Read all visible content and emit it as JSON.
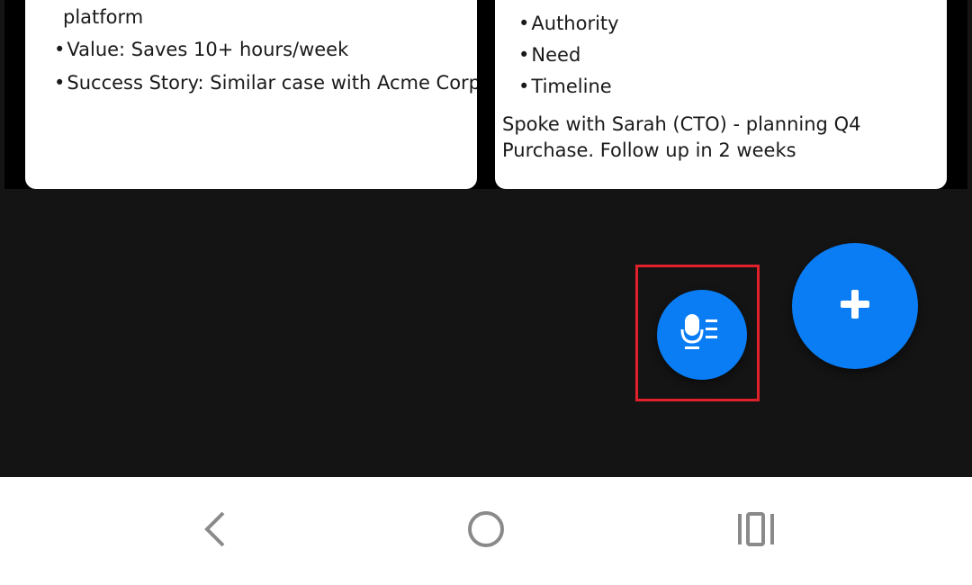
{
  "notes": {
    "left_card": {
      "top_line": "platform",
      "bullets": [
        "Value: Saves 10+ hours/week",
        "Success Story: Similar case with Acme Corp"
      ]
    },
    "right_card": {
      "bullets": [
        "Authority",
        "Need",
        "Timeline"
      ],
      "summary": "Spoke with Sarah (CTO) - planning Q4 Purchase. Follow up in 2 weeks"
    }
  },
  "fabs": {
    "voice_note_icon": "microphone-list-icon",
    "add_icon": "plus-icon",
    "accent_color": "#0a7df5"
  },
  "highlight": {
    "color": "#e0202a"
  },
  "navbar": {
    "back_icon": "chevron-left-icon",
    "home_icon": "circle-home-icon",
    "recents_icon": "recents-icon"
  }
}
